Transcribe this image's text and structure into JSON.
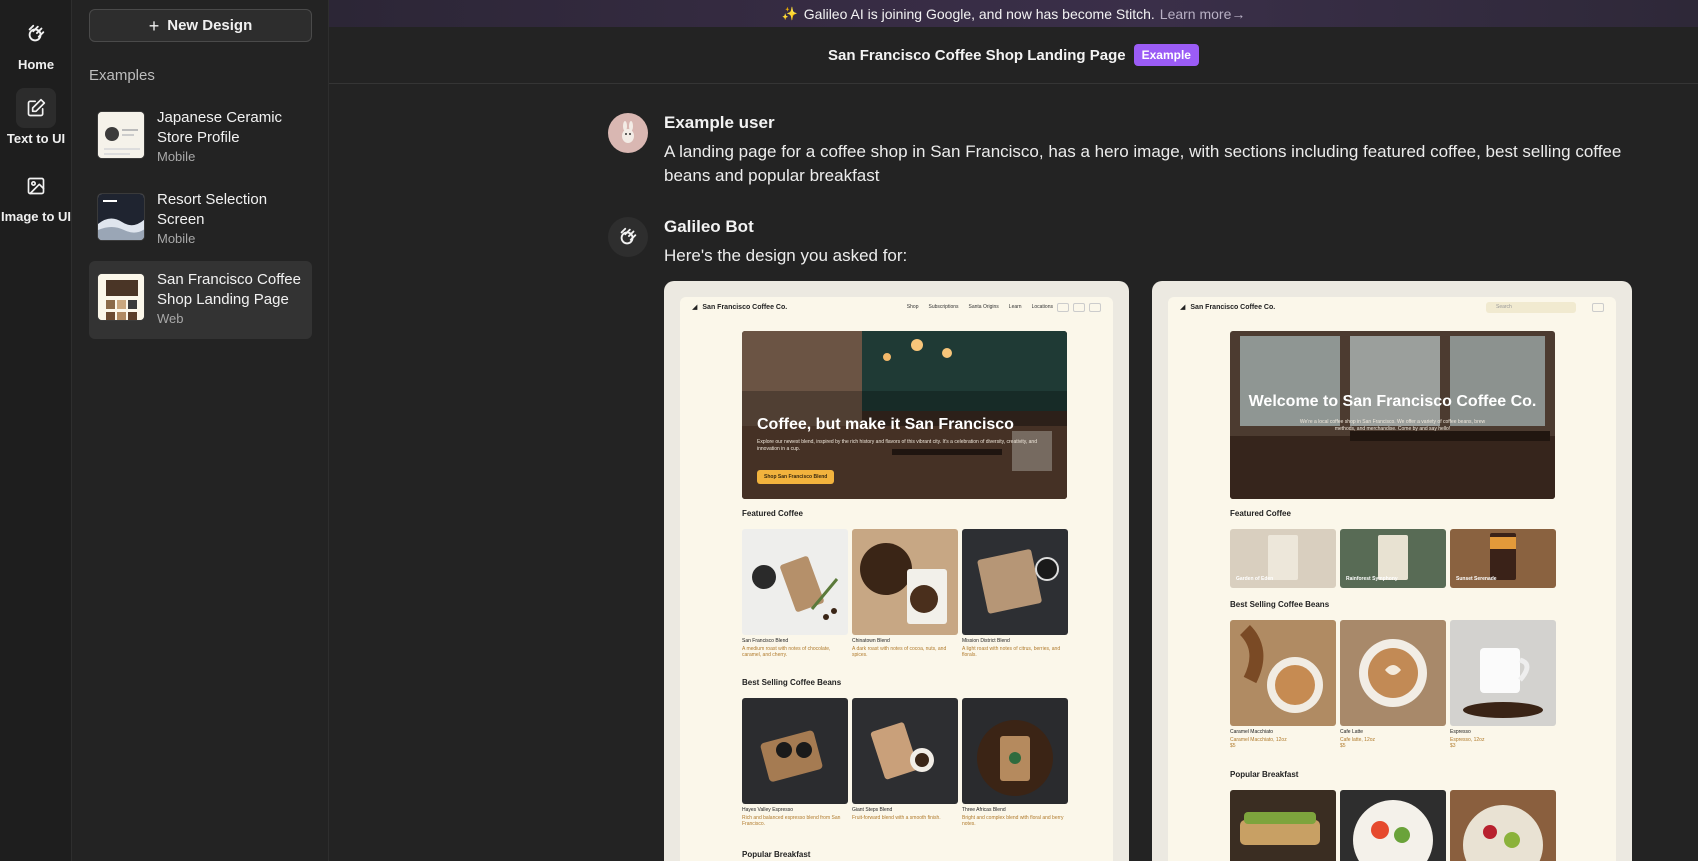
{
  "rail": {
    "items": [
      {
        "label": "Home"
      },
      {
        "label": "Text to UI"
      },
      {
        "label": "Image to UI"
      }
    ]
  },
  "sidebar": {
    "new_design": "New Design",
    "examples_title": "Examples",
    "examples": [
      {
        "name": "Japanese Ceramic Store Profile",
        "type": "Mobile"
      },
      {
        "name": "Resort Selection Screen",
        "type": "Mobile"
      },
      {
        "name": "San Francisco Coffee Shop Landing Page",
        "type": "Web"
      }
    ]
  },
  "banner": {
    "text": "Galileo AI is joining Google, and now has become Stitch.",
    "learn_more": "Learn more→"
  },
  "topbar": {
    "title": "San Francisco Coffee Shop Landing Page",
    "badge": "Example"
  },
  "conversation": {
    "user_name": "Example user",
    "user_message": "A landing page for a coffee shop in San Francisco, has a hero image, with sections including featured coffee, best selling coffee beans and popular breakfast",
    "bot_name": "Galileo Bot",
    "bot_message": "Here's the design you asked for:"
  },
  "design_a": {
    "brand": "San Francisco Coffee Co.",
    "nav": [
      "Shop",
      "Subscriptions",
      "Santa Origins",
      "Learn",
      "Locations"
    ],
    "hero_title": "Coffee, but make it San Francisco",
    "hero_sub": "Explore our newest blend, inspired by the rich history and flavors of this vibrant city. It's a celebration of diversity, creativity, and innovation in a cup.",
    "hero_cta": "Shop San Francisco Blend",
    "featured_title": "Featured Coffee",
    "featured": [
      {
        "name": "San Francisco Blend",
        "desc": "A medium roast with notes of chocolate, caramel, and cherry."
      },
      {
        "name": "Chinatown Blend",
        "desc": "A dark roast with notes of cocoa, nuts, and spices."
      },
      {
        "name": "Mission District Blend",
        "desc": "A light roast with notes of citrus, berries, and florals."
      }
    ],
    "best_title": "Best Selling Coffee Beans",
    "best": [
      {
        "name": "Hayes Valley Espresso",
        "desc": "Rich and balanced espresso blend from San Francisco."
      },
      {
        "name": "Giant Steps Blend",
        "desc": "Fruit-forward blend with a smooth finish."
      },
      {
        "name": "Three Africas Blend",
        "desc": "Bright and complex blend with floral and berry notes."
      }
    ],
    "breakfast_title": "Popular Breakfast"
  },
  "design_b": {
    "brand": "San Francisco Coffee Co.",
    "search_placeholder": "Search",
    "hero_title": "Welcome to San Francisco Coffee Co.",
    "hero_sub": "We're a local coffee shop in San Francisco. We offer a variety of coffee beans, brew methods, and merchandise. Come by and say hello!",
    "featured_title": "Featured Coffee",
    "featured": [
      "Garden of Eden",
      "Rainforest Symphony",
      "Sunset Serenade"
    ],
    "best_title": "Best Selling Coffee Beans",
    "best": [
      {
        "name": "Caramel Macchiato",
        "desc": "Caramel Macchiato, 12oz",
        "price": "$5"
      },
      {
        "name": "Cafe Latte",
        "desc": "Cafe latte, 12oz",
        "price": "$5"
      },
      {
        "name": "Espresso",
        "desc": "Espresso, 12oz",
        "price": "$3"
      }
    ],
    "breakfast_title": "Popular Breakfast"
  }
}
